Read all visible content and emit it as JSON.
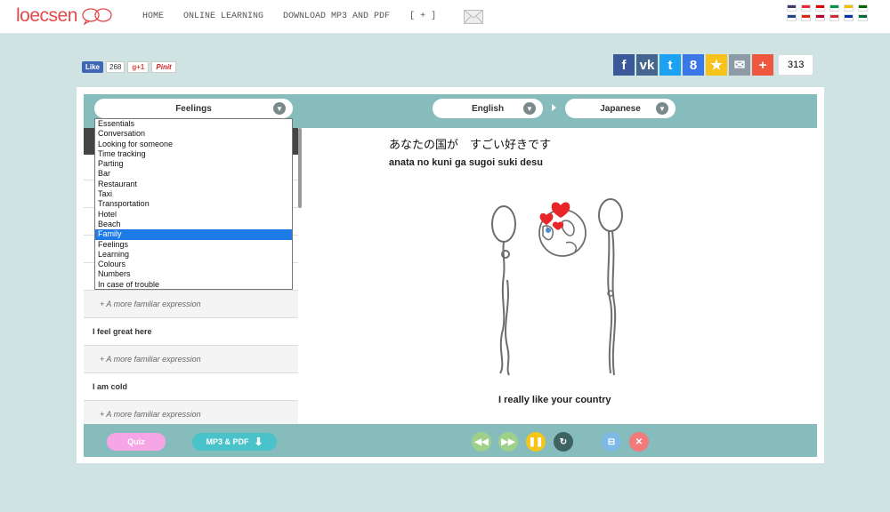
{
  "header": {
    "logo": "loecsen",
    "nav": [
      "HOME",
      "ONLINE LEARNING",
      "DOWNLOAD MP3 AND PDF",
      "[ + ]"
    ],
    "flags": [
      {
        "name": "us-flag",
        "color": "#3c3b6e"
      },
      {
        "name": "fr-flag",
        "color": "#ed2939"
      },
      {
        "name": "de-flag",
        "color": "#dd0000"
      },
      {
        "name": "it-flag",
        "color": "#009246"
      },
      {
        "name": "es-flag",
        "color": "#f1bf00"
      },
      {
        "name": "pt-flag",
        "color": "#006600"
      },
      {
        "name": "nl-flag",
        "color": "#21468b"
      },
      {
        "name": "cn-flag",
        "color": "#de2910"
      },
      {
        "name": "jp-flag",
        "color": "#bc002d"
      },
      {
        "name": "kr-flag",
        "color": "#cd2e3a"
      },
      {
        "name": "ru-flag",
        "color": "#0039a6"
      },
      {
        "name": "sa-flag",
        "color": "#006c35"
      }
    ]
  },
  "social": {
    "fb_like": "Like",
    "fb_count": "268",
    "gplus": "g+1",
    "pinit": "Pinit",
    "share_count": "313",
    "share_buttons": [
      {
        "name": "facebook-share-icon",
        "glyph": "f",
        "color": "#3b5998"
      },
      {
        "name": "vk-share-icon",
        "glyph": "vk",
        "color": "#45668e"
      },
      {
        "name": "twitter-share-icon",
        "glyph": "t",
        "color": "#1da1f2"
      },
      {
        "name": "google-share-icon",
        "glyph": "8",
        "color": "#3b78e7"
      },
      {
        "name": "favorite-star-icon",
        "glyph": "★",
        "color": "#f7c31a"
      },
      {
        "name": "email-share-icon",
        "glyph": "✉",
        "color": "#8e9ba6"
      },
      {
        "name": "more-share-icon",
        "glyph": "+",
        "color": "#f0573f"
      }
    ]
  },
  "selectors": {
    "category": "Feelings",
    "source_language": "English",
    "target_language": "Japanese"
  },
  "dropdown": {
    "options": [
      "Essentials",
      "Conversation",
      "Looking for someone",
      "Time tracking",
      "Parting",
      "Bar",
      "Restaurant",
      "Taxi",
      "Transportation",
      "Hotel",
      "Beach",
      "Family",
      "Feelings",
      "Learning",
      "Colours",
      "Numbers",
      "In case of trouble"
    ],
    "highlighted": "Family"
  },
  "phrases": {
    "rows": [
      {
        "type": "sub",
        "text": "+ A more familiar expression"
      },
      {
        "type": "head",
        "text": "I feel great here"
      },
      {
        "type": "sub",
        "text": "+ A more familiar expression"
      },
      {
        "type": "head",
        "text": "I am cold"
      },
      {
        "type": "sub",
        "text": "+ A more familiar expression"
      }
    ]
  },
  "content": {
    "japanese": "あなたの国が　すごい好きです",
    "romaji": "anata no kuni ga sugoi suki desu",
    "translation": "I really like your country"
  },
  "footer": {
    "quiz": "Quiz",
    "mp3_pdf": "MP3 & PDF",
    "controls": [
      {
        "name": "rewind-button",
        "glyph": "◀◀",
        "color": "#9fd08a"
      },
      {
        "name": "forward-button",
        "glyph": "▶▶",
        "color": "#9fd08a"
      },
      {
        "name": "pause-button",
        "glyph": "❚❚",
        "color": "#f5c51a"
      },
      {
        "name": "repeat-button",
        "glyph": "↻",
        "color": "#3f6363"
      },
      {
        "name": "settings-sliders-button",
        "glyph": "⊟",
        "color": "#7fb9e6"
      },
      {
        "name": "shuffle-button",
        "glyph": "✕",
        "color": "#f37a7a"
      }
    ]
  }
}
